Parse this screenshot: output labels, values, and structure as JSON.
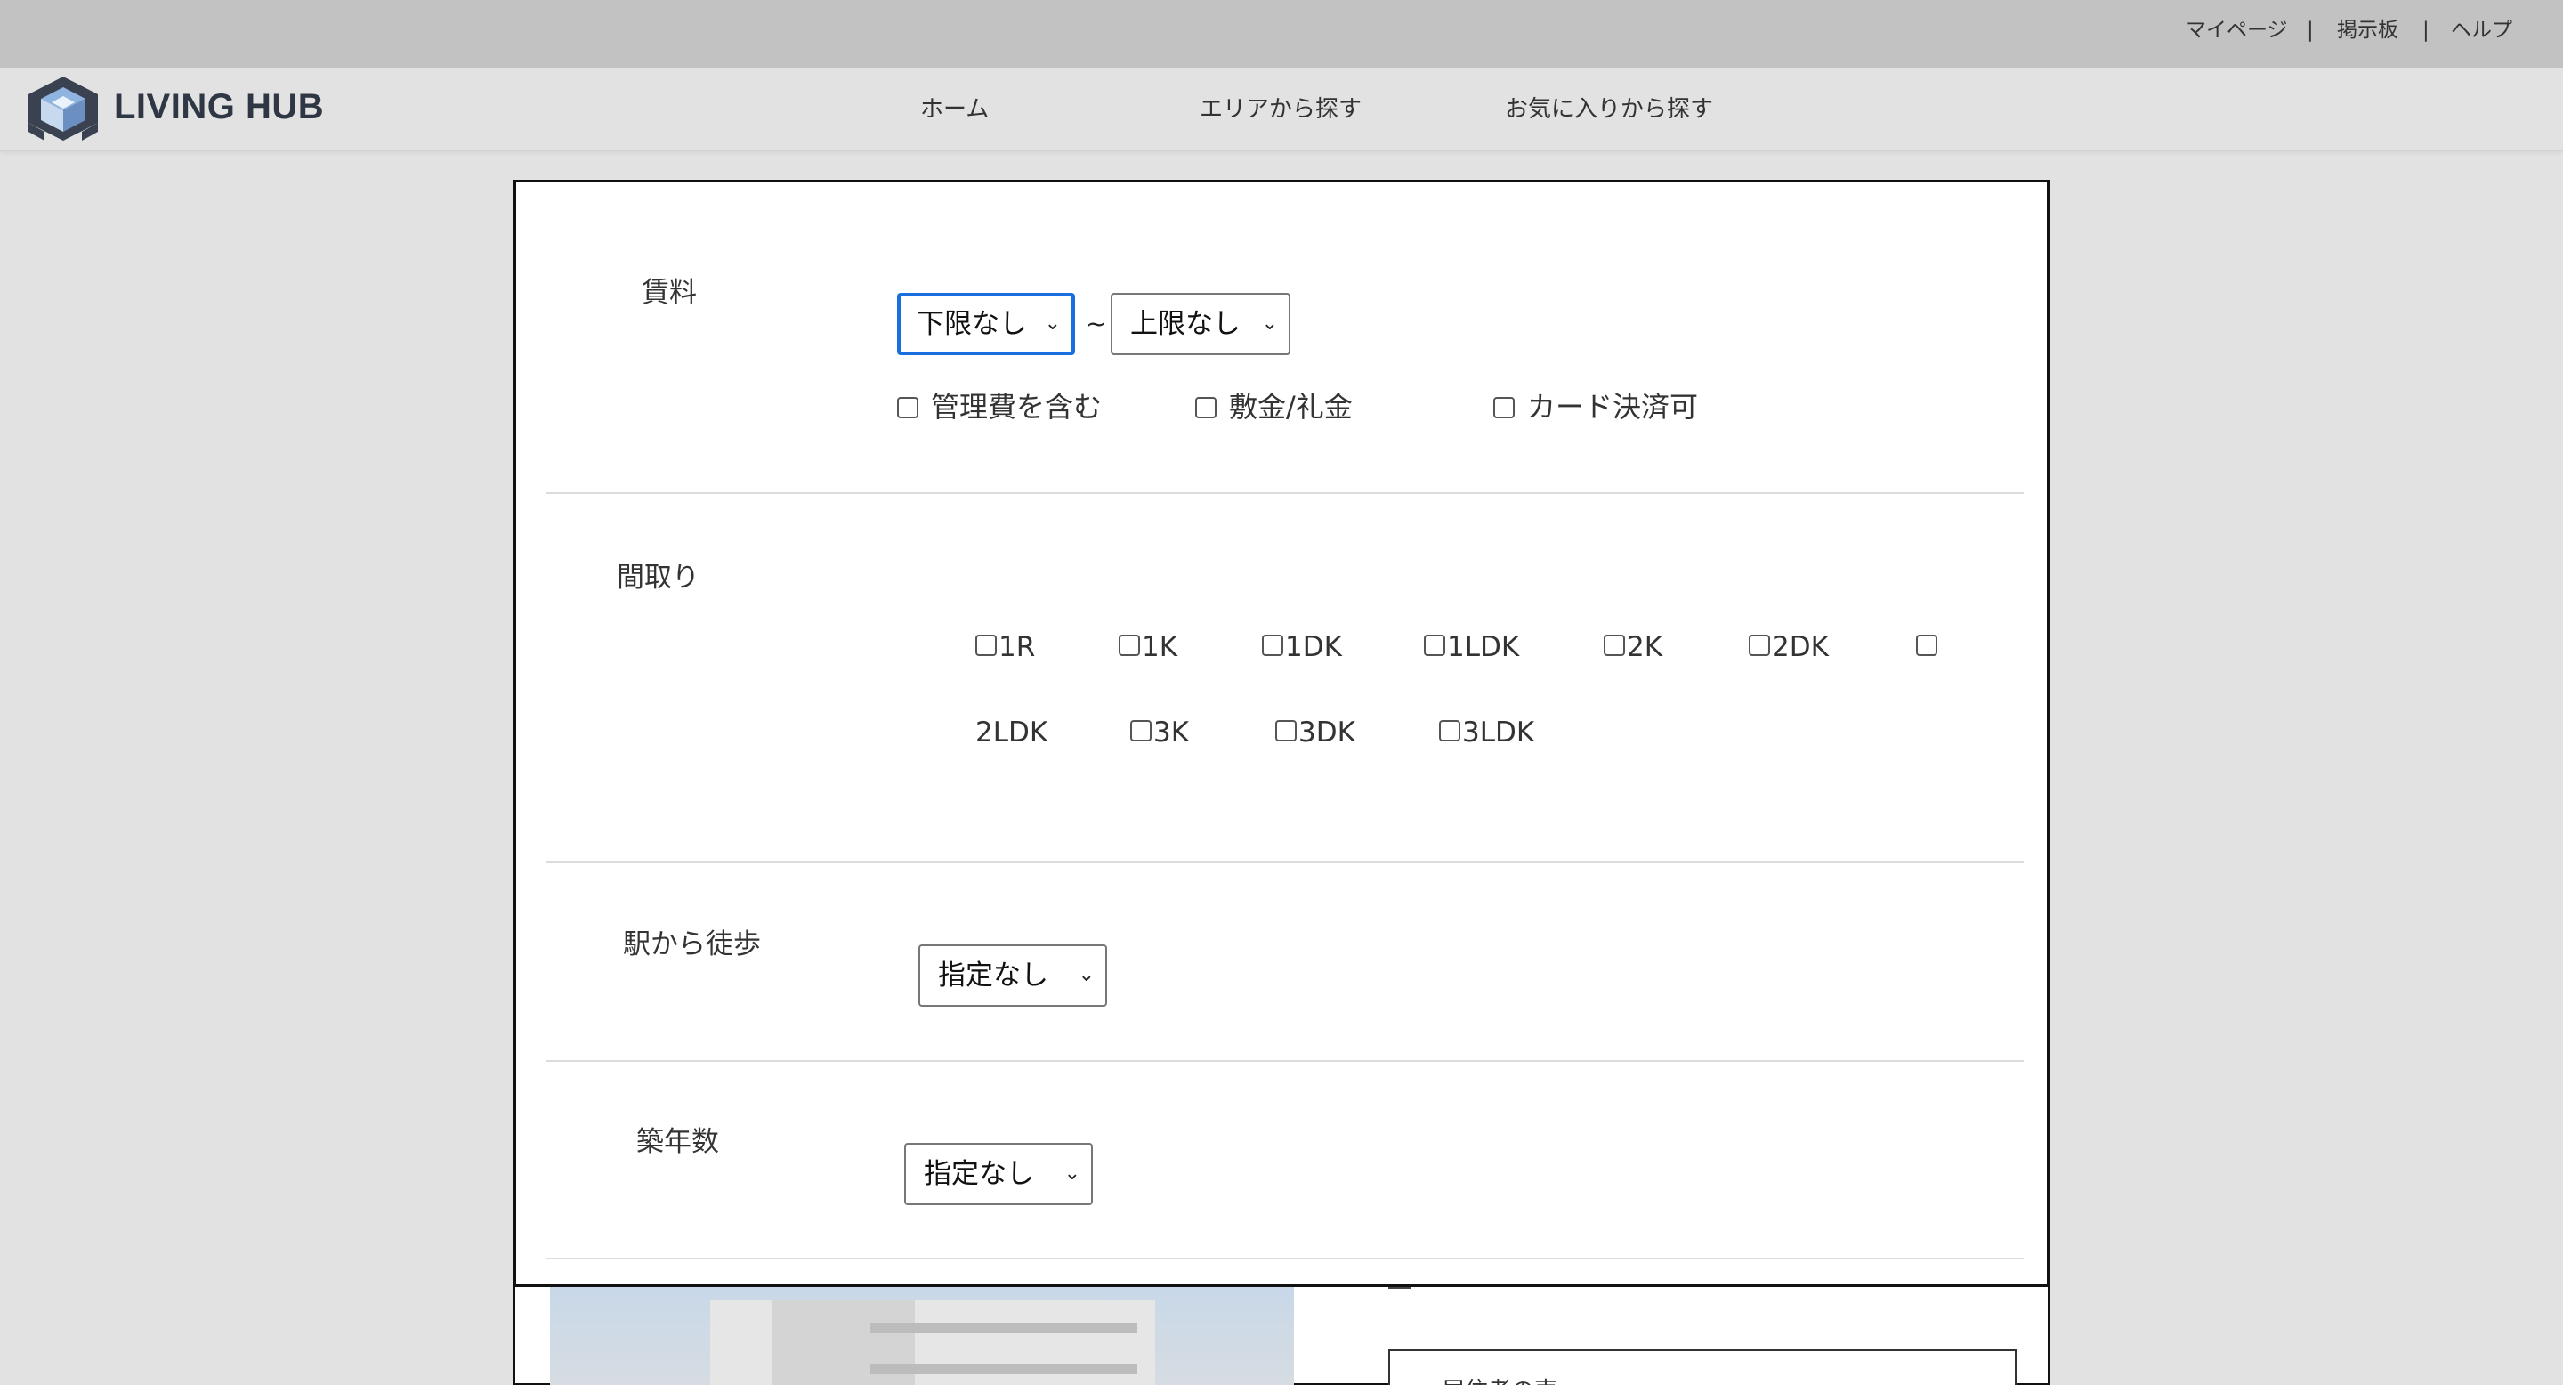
{
  "utility": {
    "mypage": "マイページ",
    "board": "掲示板",
    "help": "ヘルプ",
    "sep": "|"
  },
  "header": {
    "brand": "LIVING HUB",
    "nav": [
      "ホーム",
      "エリアから探す",
      "お気に入りから探す"
    ]
  },
  "search": {
    "rent": {
      "label": "賃料",
      "min": "下限なし",
      "max": "上限なし",
      "range_sep": "~",
      "options": [
        "管理費を含む",
        "敷金/礼金",
        "カード決済可"
      ]
    },
    "layout": {
      "label": "間取り",
      "options": [
        "1R",
        "1K",
        "1DK",
        "1LDK",
        "2K",
        "2DK",
        "2LDK",
        "3K",
        "3DK",
        "3LDK"
      ]
    },
    "walk": {
      "label": "駅から徒歩",
      "value": "指定なし"
    },
    "age": {
      "label": "築年数",
      "value": "指定なし"
    }
  },
  "background": {
    "partial_box_text": "居住者の声"
  },
  "colors": {
    "topbar": "#c2c2c2",
    "header": "#e2e2e2",
    "focus": "#1a6fe0",
    "brand_text": "#2f3644"
  },
  "icons": {
    "select_arrow": "chevron-down-icon",
    "logo": "cube-logo-icon"
  }
}
